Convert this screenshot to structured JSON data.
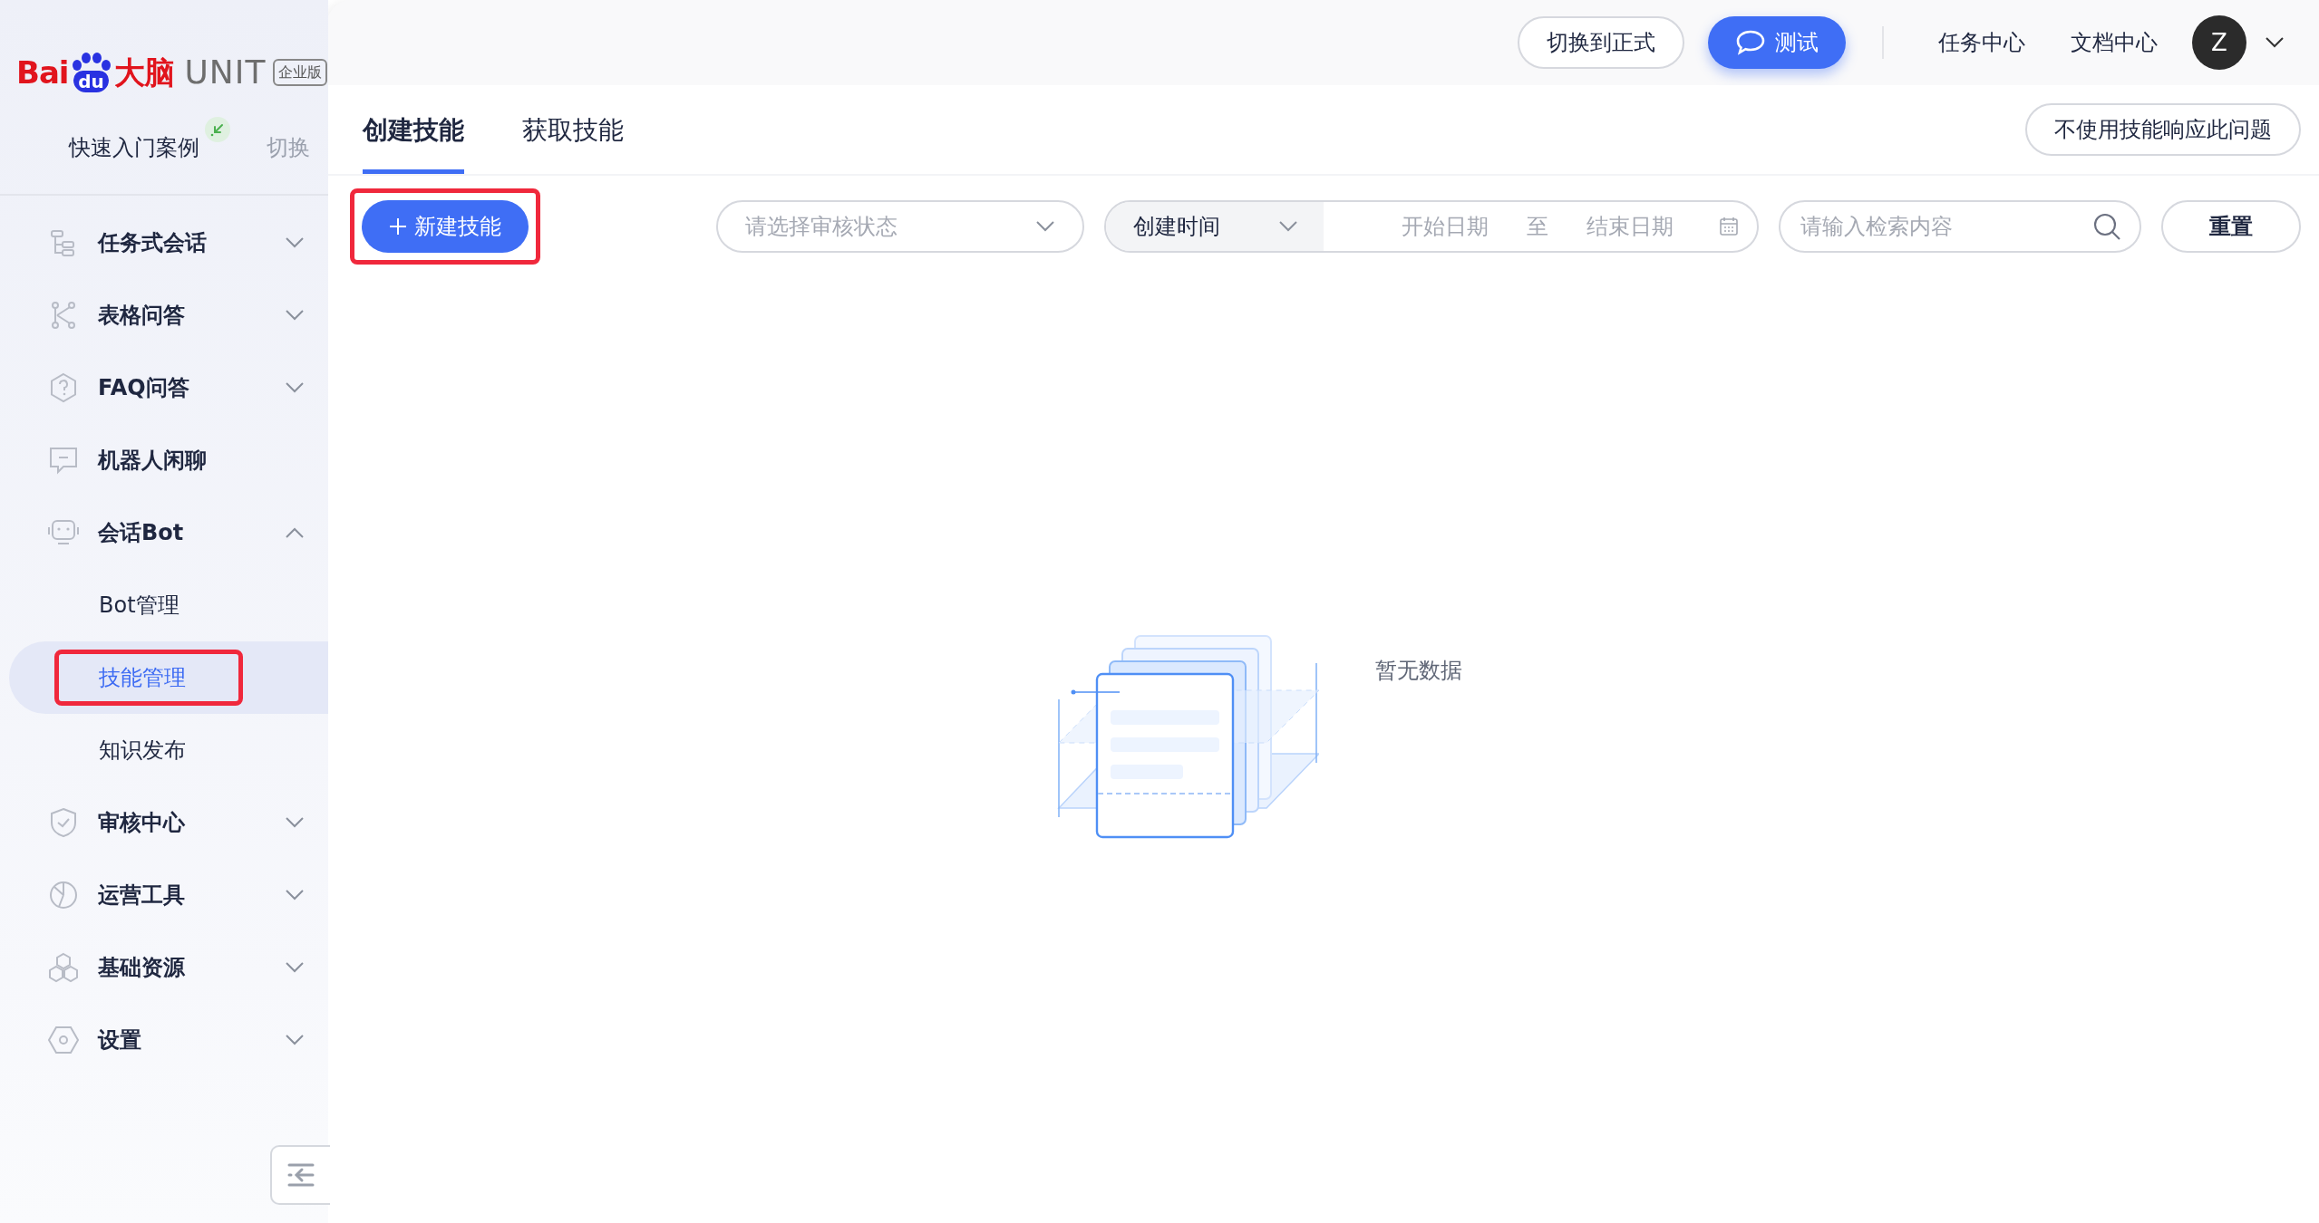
{
  "logo": {
    "brand": "Bai",
    "paw_text": "du",
    "product": "大脑",
    "name": "UNIT",
    "edition": "企业版"
  },
  "quickstart": {
    "label": "快速入门案例",
    "switch": "切换"
  },
  "menu": [
    {
      "kind": "group",
      "label": "任务式会话",
      "expanded": false
    },
    {
      "kind": "group",
      "label": "表格问答",
      "expanded": false
    },
    {
      "kind": "group",
      "label": "FAQ问答",
      "expanded": false
    },
    {
      "kind": "link",
      "label": "机器人闲聊"
    },
    {
      "kind": "group",
      "label": "会话Bot",
      "expanded": true,
      "children": [
        {
          "label": "Bot管理",
          "selected": false,
          "highlighted": false
        },
        {
          "label": "技能管理",
          "selected": true,
          "highlighted": true
        },
        {
          "label": "知识发布",
          "selected": false,
          "highlighted": false
        }
      ]
    },
    {
      "kind": "group",
      "label": "审核中心",
      "expanded": false
    },
    {
      "kind": "group",
      "label": "运营工具",
      "expanded": false
    },
    {
      "kind": "group",
      "label": "基础资源",
      "expanded": false
    },
    {
      "kind": "group",
      "label": "设置",
      "expanded": false
    }
  ],
  "header": {
    "buttons": [
      {
        "kind": "outline",
        "label": "切换到正式"
      },
      {
        "kind": "primary",
        "label": "测试"
      }
    ],
    "links": [
      "任务中心",
      "文档中心"
    ],
    "avatar": "Z"
  },
  "tabs": [
    {
      "label": "创建技能",
      "selected": true
    },
    {
      "label": "获取技能",
      "selected": false
    }
  ],
  "no_skill_button": "不使用技能响应此问题",
  "toolbar": {
    "new_button": {
      "label": "新建技能",
      "highlighted": true
    },
    "status_select": {
      "placeholder": "请选择审核状态"
    },
    "date_type": "创建时间",
    "start_date": {
      "placeholder": "开始日期"
    },
    "range_separator": "至",
    "end_date": {
      "placeholder": "结束日期"
    },
    "search": {
      "placeholder": "请输入检索内容"
    },
    "reset": "重置"
  },
  "empty_text": "暂无数据"
}
